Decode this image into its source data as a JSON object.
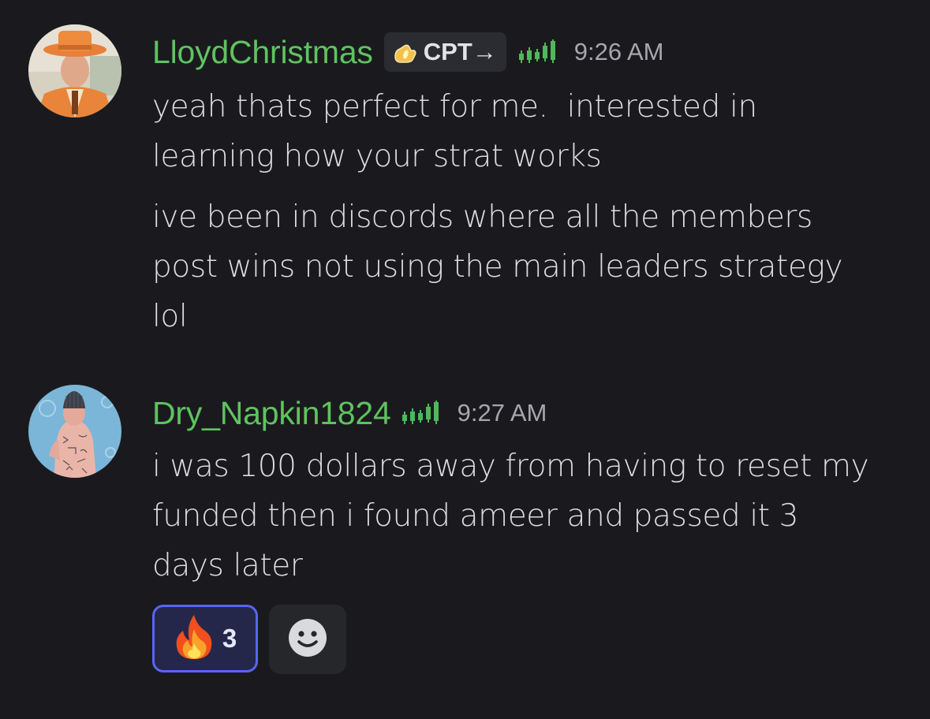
{
  "messages": [
    {
      "username": "LloydChristmas",
      "tag": "CPT→",
      "tag_icon": "flame-hand-badge-icon",
      "role_icon": "candlestick-chart-icon",
      "time": "9:26 AM",
      "paragraphs": [
        [
          "yeah thats perfect for me.  interested in",
          "learning how your strat works"
        ],
        [
          "ive been in discords where all the members",
          "post wins not using the main leaders strategy",
          "lol"
        ]
      ]
    },
    {
      "username": "Dry_Napkin1824",
      "role_icon": "candlestick-chart-icon",
      "time": "9:27 AM",
      "paragraphs": [
        [
          "i was 100 dollars away from having to reset my",
          "funded then i found ameer and passed it 3",
          "days later"
        ]
      ],
      "reactions": [
        {
          "emoji": "fire-emoji-icon",
          "count": "3"
        }
      ],
      "add_reaction_icon": "smiley-face-icon"
    }
  ],
  "colors": {
    "background": "#1a1a1e",
    "username": "#5fc35f",
    "text": "#dcdde1",
    "timestamp": "#a6a7ad",
    "reaction_border": "#5865f2",
    "reaction_bg": "#25274a"
  }
}
